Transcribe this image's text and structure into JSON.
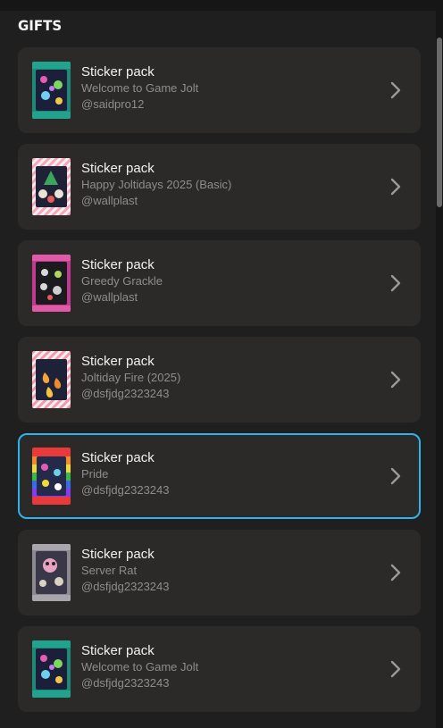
{
  "header": {
    "title": "GIFTS"
  },
  "gifts": [
    {
      "name": "Sticker pack",
      "game": "Welcome to Game Jolt",
      "user": "@saidpro12",
      "theme": "teal"
    },
    {
      "name": "Sticker pack",
      "game": "Happy Joltidays 2025 (Basic)",
      "user": "@wallplast",
      "theme": "candy"
    },
    {
      "name": "Sticker pack",
      "game": "Greedy Grackle",
      "user": "@wallplast",
      "theme": "magenta"
    },
    {
      "name": "Sticker pack",
      "game": "Joltiday Fire (2025)",
      "user": "@dsfjdg2323243",
      "theme": "candy-fire"
    },
    {
      "name": "Sticker pack",
      "game": "Pride",
      "user": "@dsfjdg2323243",
      "theme": "rainbow",
      "selected": true
    },
    {
      "name": "Sticker pack",
      "game": "Server Rat",
      "user": "@dsfjdg2323243",
      "theme": "grey"
    },
    {
      "name": "Sticker pack",
      "game": "Welcome to Game Jolt",
      "user": "@dsfjdg2323243",
      "theme": "teal"
    }
  ],
  "colors": {
    "accent": "#2fb4ea",
    "card": "#2b2a29",
    "background": "#1f1f1f"
  }
}
